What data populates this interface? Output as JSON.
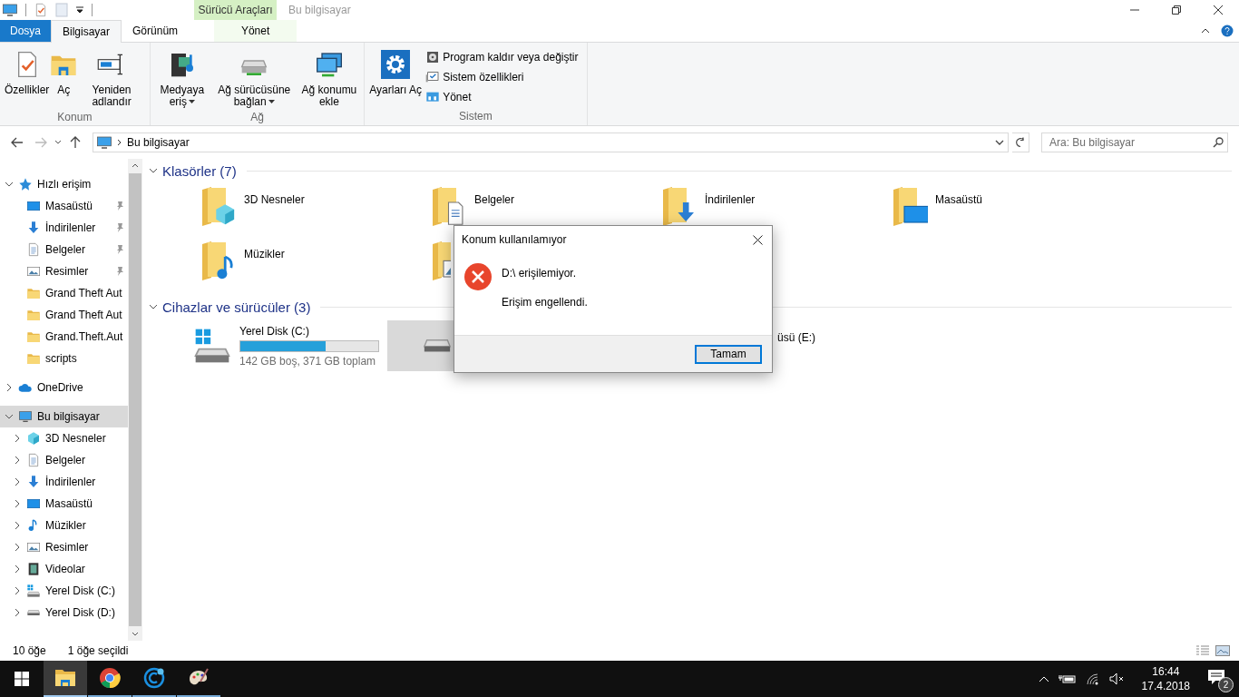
{
  "window": {
    "title": "Bu bilgisayar",
    "context_group": "Sürücü Araçları"
  },
  "ribbon_tabs": [
    {
      "label": "Dosya",
      "kind": "file",
      "selected": false
    },
    {
      "label": "Bilgisayar",
      "kind": "tab",
      "selected": true
    },
    {
      "label": "Görünüm",
      "kind": "tab",
      "selected": false
    },
    {
      "label": "Yönet",
      "kind": "context",
      "selected": false
    }
  ],
  "ribbon_groups": [
    {
      "label": "Konum",
      "buttons": [
        {
          "label": "Özellikler",
          "kind": "properties"
        },
        {
          "label": "Aç",
          "kind": "open"
        },
        {
          "label": "Yeniden adlandır",
          "kind": "rename"
        }
      ]
    },
    {
      "label": "Ağ",
      "buttons": [
        {
          "label": "Medyaya eriş",
          "kind": "media",
          "dropdown": true
        },
        {
          "label": "Ağ sürücüsüne bağlan",
          "kind": "netdrive",
          "dropdown": true
        },
        {
          "label": "Ağ konumu ekle",
          "kind": "netloc"
        }
      ]
    },
    {
      "label": "Sistem",
      "buttons": [
        {
          "label": "Ayarları Aç",
          "kind": "settings"
        }
      ],
      "small_buttons": [
        {
          "label": "Program kaldır veya değiştir",
          "kind": "program"
        },
        {
          "label": "Sistem özellikleri",
          "kind": "sysprops"
        },
        {
          "label": "Yönet",
          "kind": "manage"
        }
      ]
    }
  ],
  "address": {
    "path": "Bu bilgisayar",
    "search_placeholder": "Ara: Bu bilgisayar"
  },
  "nav_tree": [
    {
      "label": "Hızlı erişim",
      "kind": "star",
      "expanded": true,
      "selected": false,
      "children": [
        {
          "label": "Masaüstü",
          "kind": "desktop",
          "pinned": true,
          "selected": false
        },
        {
          "label": "İndirilenler",
          "kind": "download",
          "pinned": true,
          "selected": false
        },
        {
          "label": "Belgeler",
          "kind": "doc",
          "pinned": true,
          "selected": false
        },
        {
          "label": "Resimler",
          "kind": "picture",
          "pinned": true,
          "selected": false
        },
        {
          "label": "Grand Theft Aut",
          "kind": "folder",
          "pinned": false,
          "selected": false
        },
        {
          "label": "Grand Theft Aut",
          "kind": "folder",
          "pinned": false,
          "selected": false
        },
        {
          "label": "Grand.Theft.Aut",
          "kind": "folder",
          "pinned": false,
          "selected": false
        },
        {
          "label": "scripts",
          "kind": "folder",
          "pinned": false,
          "selected": false
        }
      ]
    },
    {
      "label": "OneDrive",
      "kind": "cloud",
      "expanded": false,
      "selected": false
    },
    {
      "label": "Bu bilgisayar",
      "kind": "pc",
      "expanded": true,
      "selected": true,
      "children": [
        {
          "label": "3D Nesneler",
          "kind": "cube",
          "expanded": false,
          "selected": false
        },
        {
          "label": "Belgeler",
          "kind": "doc",
          "expanded": false,
          "selected": false
        },
        {
          "label": "İndirilenler",
          "kind": "download",
          "expanded": false,
          "selected": false
        },
        {
          "label": "Masaüstü",
          "kind": "desktop",
          "expanded": false,
          "selected": false
        },
        {
          "label": "Müzikler",
          "kind": "music",
          "expanded": false,
          "selected": false
        },
        {
          "label": "Resimler",
          "kind": "picture",
          "expanded": false,
          "selected": false
        },
        {
          "label": "Videolar",
          "kind": "video",
          "expanded": false,
          "selected": false
        },
        {
          "label": "Yerel Disk (C:)",
          "kind": "windrive",
          "expanded": false,
          "selected": false
        },
        {
          "label": "Yerel Disk (D:)",
          "kind": "drive",
          "expanded": false,
          "selected": false
        }
      ]
    }
  ],
  "folders_section": {
    "title": "Klasörler (7)",
    "expanded": true,
    "items": [
      {
        "label": "3D Nesneler",
        "kind": "cube"
      },
      {
        "label": "Belgeler",
        "kind": "doc"
      },
      {
        "label": "İndirilenler",
        "kind": "download"
      },
      {
        "label": "Masaüstü",
        "kind": "desktop"
      },
      {
        "label": "Müzikler",
        "kind": "music"
      },
      {
        "kind": "picture"
      }
    ]
  },
  "drives_section": {
    "title": "Cihazlar ve sürücüler (3)",
    "expanded": true,
    "items": [
      {
        "kind": "disk",
        "label": "Yerel Disk (C:)",
        "level": 0.62,
        "info": "142 GB boş, 371 GB toplam",
        "selected": false
      },
      {
        "kind": "covered",
        "selected": true
      },
      {
        "kind": "label_only",
        "label": "üsü (E:)",
        "selected": false
      }
    ]
  },
  "dialog": {
    "title": "Konum kullanılamıyor",
    "message": "D:\\ erişilemiyor.",
    "detail": "Erişim engellendi.",
    "button": "Tamam"
  },
  "status_bar": {
    "item_count": "10 öğe",
    "selection": "1 öğe seçildi"
  },
  "taskbar": {
    "apps": [
      {
        "kind": "explorer",
        "active": true
      },
      {
        "kind": "chrome",
        "active": false
      },
      {
        "kind": "sync",
        "active": false
      },
      {
        "kind": "paint",
        "active": false
      }
    ],
    "time": "16:44",
    "date": "17.4.2018",
    "notifications": "2"
  }
}
